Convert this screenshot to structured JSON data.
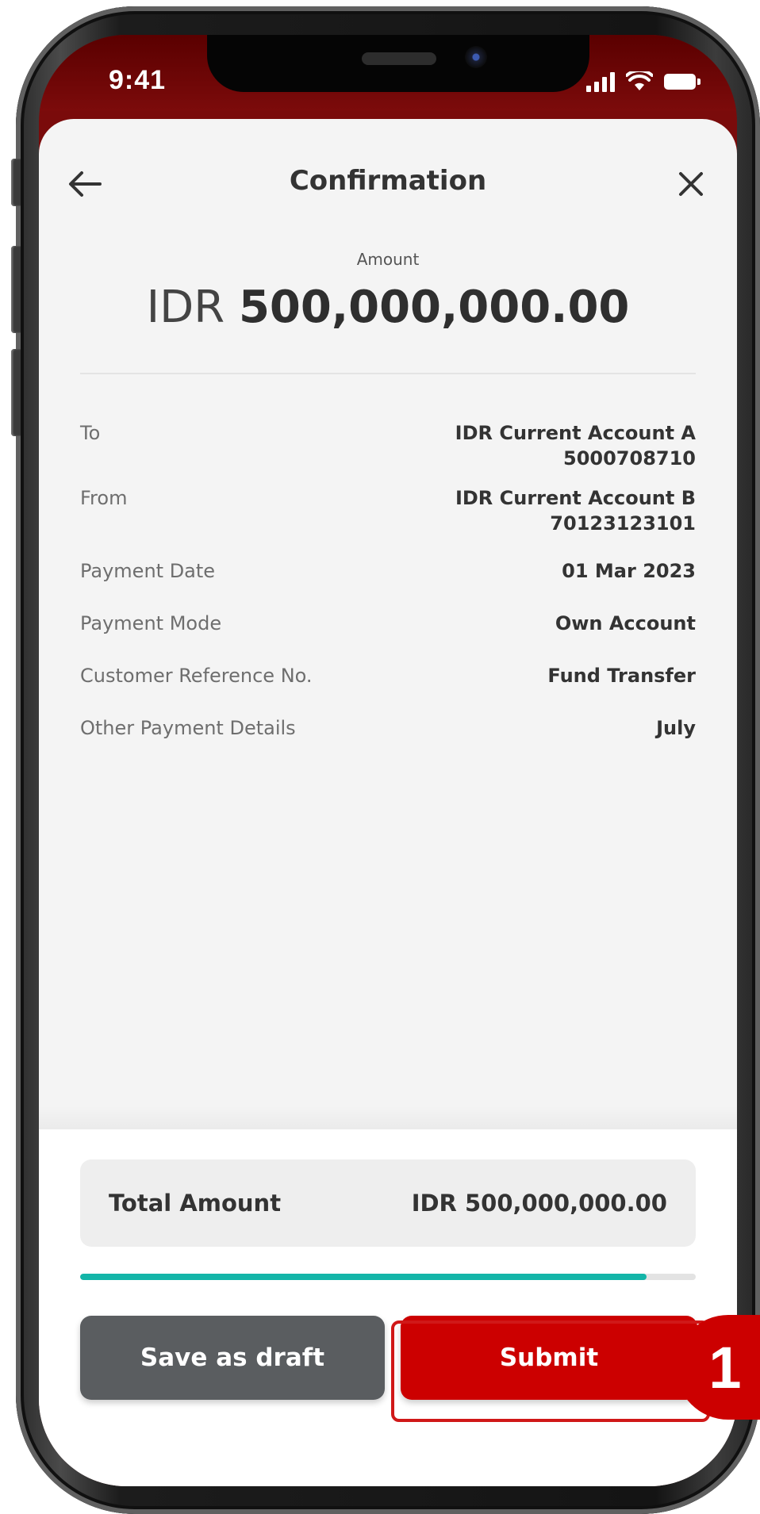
{
  "status_bar": {
    "time": "9:41"
  },
  "header": {
    "title": "Confirmation",
    "back_icon": "arrow-left-icon",
    "close_icon": "close-icon"
  },
  "amount": {
    "label": "Amount",
    "currency": "IDR",
    "value": "500,000,000.00"
  },
  "details": [
    {
      "label": "To",
      "value_lines": [
        "IDR Current Account A",
        "5000708710"
      ]
    },
    {
      "label": "From",
      "value_lines": [
        "IDR Current Account B",
        "70123123101"
      ]
    },
    {
      "label": "Payment Date",
      "value_lines": [
        "01 Mar 2023"
      ]
    },
    {
      "label": "Payment Mode",
      "value_lines": [
        "Own Account"
      ]
    },
    {
      "label": "Customer Reference No.",
      "value_lines": [
        "Fund Transfer"
      ]
    },
    {
      "label": "Other Payment Details",
      "value_lines": [
        "July"
      ]
    }
  ],
  "total": {
    "label": "Total Amount",
    "value": "IDR 500,000,000.00"
  },
  "progress": {
    "fraction": 0.92
  },
  "buttons": {
    "draft_label": "Save as draft",
    "submit_label": "Submit"
  },
  "annotation": {
    "step_number": "1"
  },
  "colors": {
    "brand_red": "#cc0000",
    "progress_teal": "#13b5a8",
    "draft_gray": "#5a5d60",
    "status_bar": "#7c0b0b"
  }
}
